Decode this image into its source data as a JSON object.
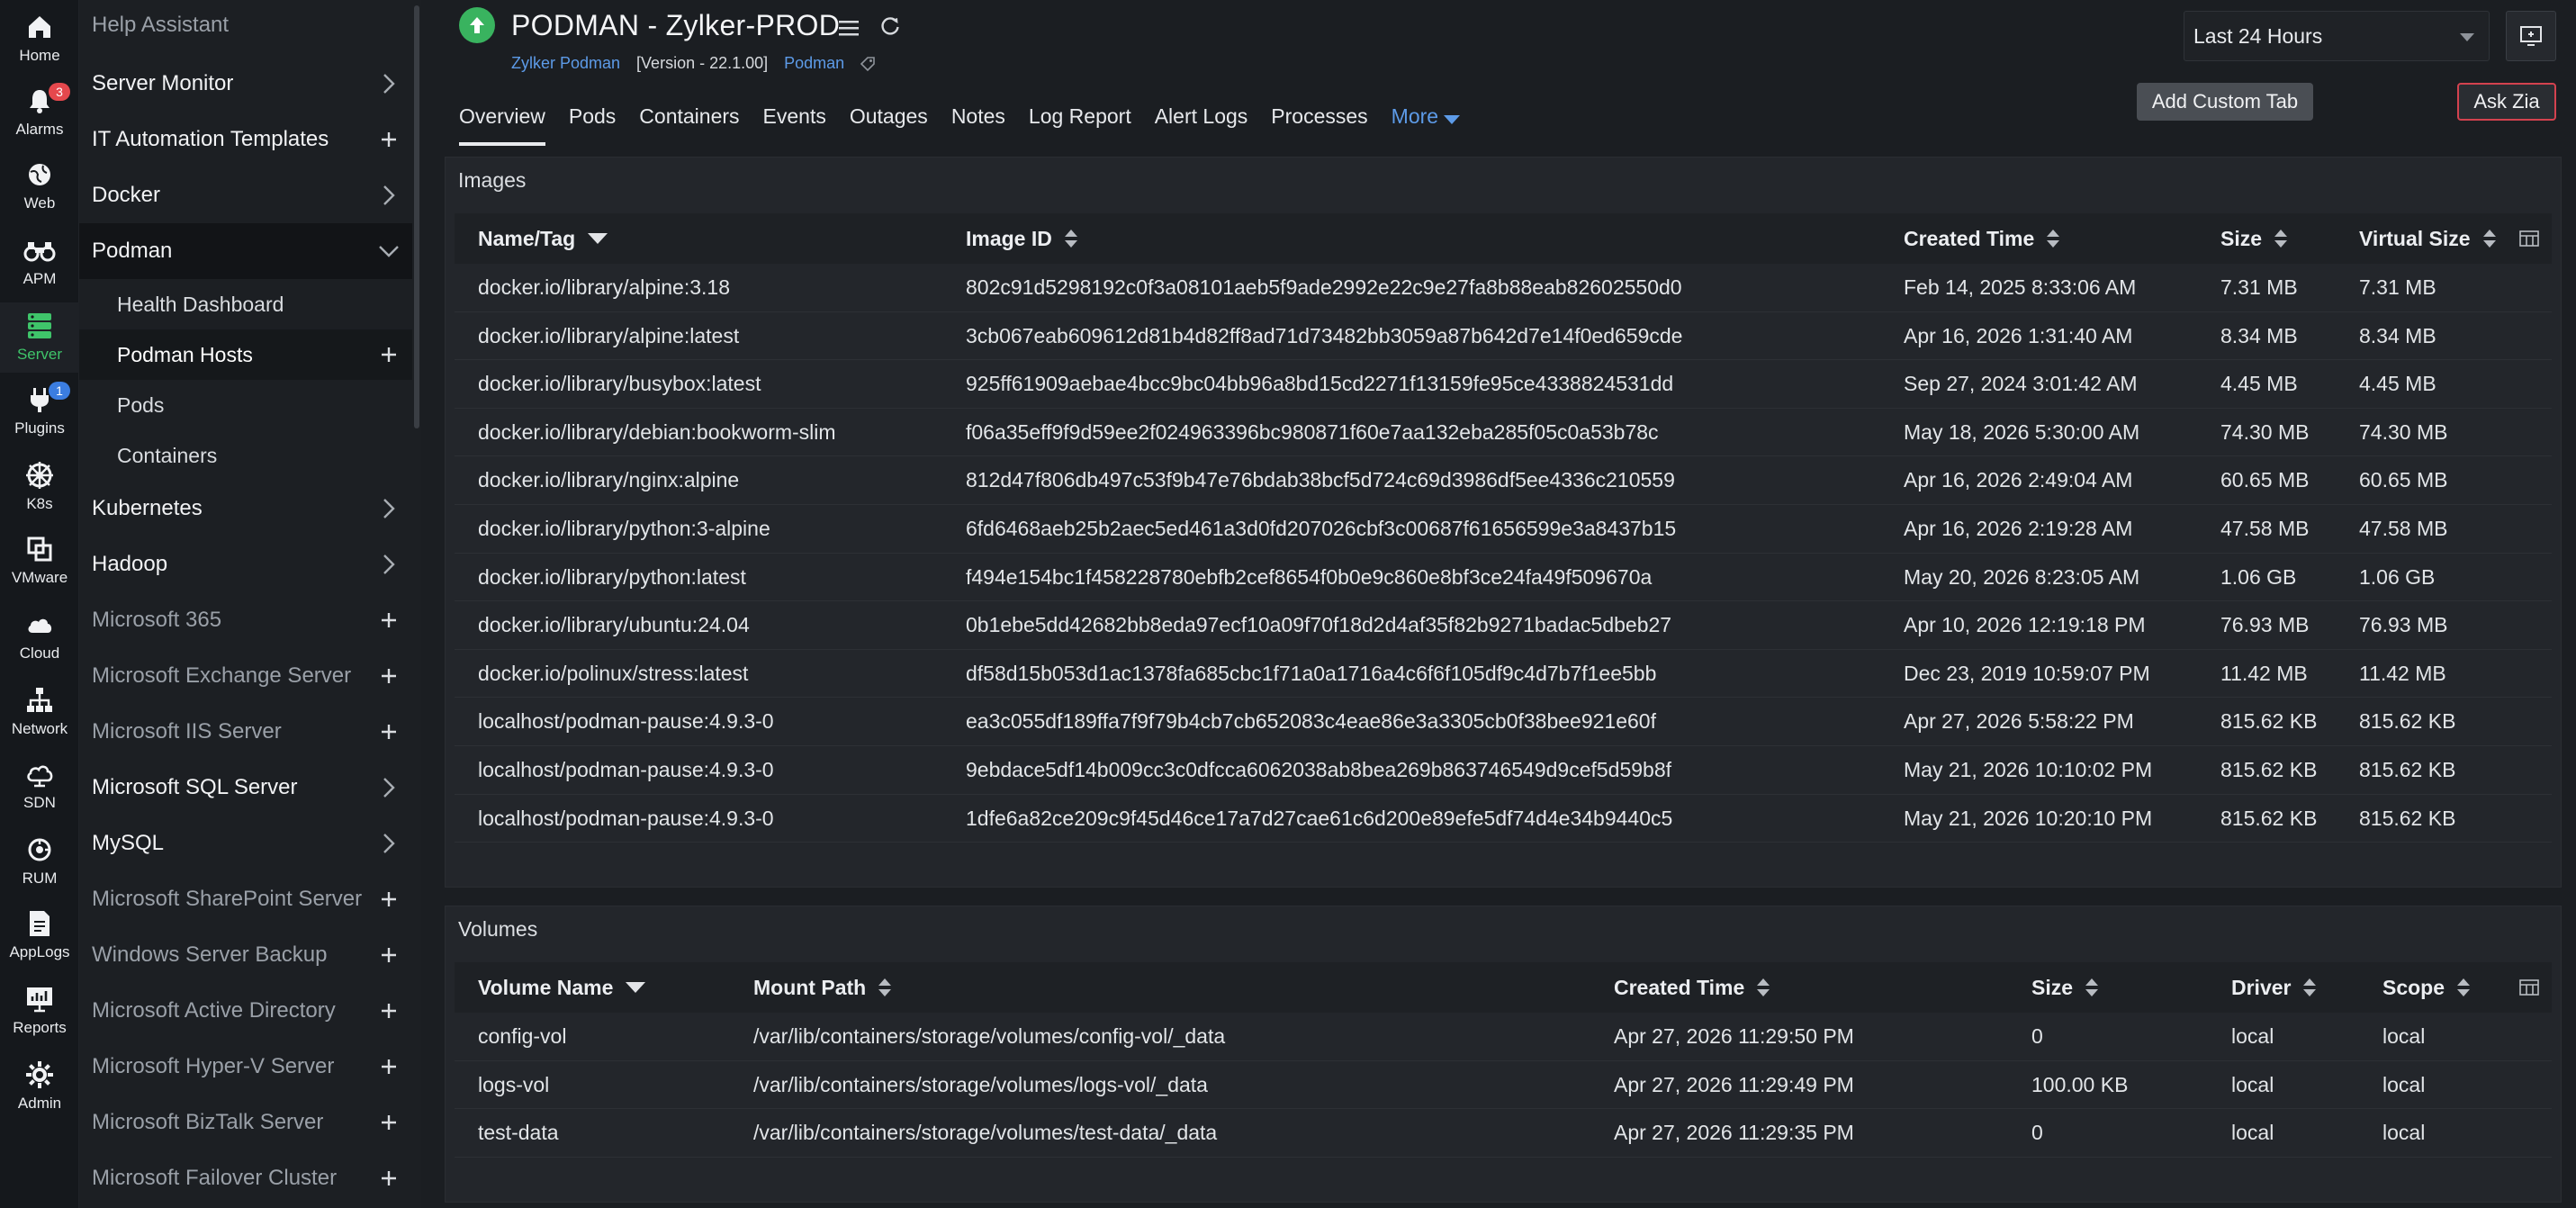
{
  "rail": [
    {
      "label": "Home",
      "icon": "home-icon"
    },
    {
      "label": "Alarms",
      "icon": "bell-icon",
      "badge": "3",
      "badge_color": "#e5484d"
    },
    {
      "label": "Web",
      "icon": "globe-icon"
    },
    {
      "label": "APM",
      "icon": "binoculars-icon"
    },
    {
      "label": "Server",
      "icon": "server-icon",
      "active": true
    },
    {
      "label": "Plugins",
      "icon": "plug-icon",
      "badge": "1",
      "badge_color": "#3b7de0"
    },
    {
      "label": "K8s",
      "icon": "helm-icon"
    },
    {
      "label": "VMware",
      "icon": "vmware-icon"
    },
    {
      "label": "Cloud",
      "icon": "cloud-icon"
    },
    {
      "label": "Network",
      "icon": "network-icon"
    },
    {
      "label": "SDN",
      "icon": "sdn-icon"
    },
    {
      "label": "RUM",
      "icon": "rum-icon"
    },
    {
      "label": "AppLogs",
      "icon": "applogs-icon"
    },
    {
      "label": "Reports",
      "icon": "reports-icon"
    },
    {
      "label": "Admin",
      "icon": "gear-icon"
    }
  ],
  "sidebar": {
    "items": [
      {
        "label": "Help Assistant",
        "control": "none",
        "dim": true
      },
      {
        "label": "Server Monitor",
        "control": "chevron"
      },
      {
        "label": "IT Automation Templates",
        "control": "plus"
      },
      {
        "label": "Docker",
        "control": "chevron"
      },
      {
        "label": "Podman",
        "control": "chevron-down",
        "open": true
      },
      {
        "label": "Health Dashboard",
        "sub": true
      },
      {
        "label": "Podman Hosts",
        "sub": true,
        "control": "plus",
        "selected": true
      },
      {
        "label": "Pods",
        "sub": true
      },
      {
        "label": "Containers",
        "sub": true
      },
      {
        "label": "Kubernetes",
        "control": "chevron"
      },
      {
        "label": "Hadoop",
        "control": "chevron"
      },
      {
        "label": "Microsoft 365",
        "control": "plus",
        "dim": true
      },
      {
        "label": "Microsoft Exchange Server",
        "control": "plus",
        "dim": true
      },
      {
        "label": "Microsoft IIS Server",
        "control": "plus",
        "dim": true
      },
      {
        "label": "Microsoft SQL Server",
        "control": "chevron"
      },
      {
        "label": "MySQL",
        "control": "chevron"
      },
      {
        "label": "Microsoft SharePoint Server",
        "control": "plus",
        "dim": true
      },
      {
        "label": "Windows Server Backup",
        "control": "plus",
        "dim": true
      },
      {
        "label": "Microsoft Active Directory",
        "control": "plus",
        "dim": true
      },
      {
        "label": "Microsoft Hyper-V Server",
        "control": "plus",
        "dim": true
      },
      {
        "label": "Microsoft BizTalk Server",
        "control": "plus",
        "dim": true
      },
      {
        "label": "Microsoft Failover Cluster",
        "control": "plus",
        "dim": true
      }
    ]
  },
  "header": {
    "title": "PODMAN - Zylker-PROD",
    "monitor_name": "Zylker Podman",
    "version": "[Version - 22.1.00]",
    "type_link": "Podman",
    "time_range": "Last 24 Hours",
    "add_custom_tab": "Add Custom Tab",
    "ask_zia": "Ask Zia"
  },
  "tabs": [
    "Overview",
    "Pods",
    "Containers",
    "Events",
    "Outages",
    "Notes",
    "Log Report",
    "Alert Logs",
    "Processes"
  ],
  "tabs_more": "More",
  "images": {
    "title": "Images",
    "columns": [
      "Name/Tag",
      "Image ID",
      "Created Time",
      "Size",
      "Virtual Size"
    ],
    "rows": [
      [
        "docker.io/library/alpine:3.18",
        "802c91d5298192c0f3a08101aeb5f9ade2992e22c9e27fa8b88eab82602550d0",
        "Feb 14, 2025 8:33:06 AM",
        "7.31 MB",
        "7.31 MB"
      ],
      [
        "docker.io/library/alpine:latest",
        "3cb067eab609612d81b4d82ff8ad71d73482bb3059a87b642d7e14f0ed659cde",
        "Apr 16, 2026 1:31:40 AM",
        "8.34 MB",
        "8.34 MB"
      ],
      [
        "docker.io/library/busybox:latest",
        "925ff61909aebae4bcc9bc04bb96a8bd15cd2271f13159fe95ce4338824531dd",
        "Sep 27, 2024 3:01:42 AM",
        "4.45 MB",
        "4.45 MB"
      ],
      [
        "docker.io/library/debian:bookworm-slim",
        "f06a35eff9f9d59ee2f024963396bc980871f60e7aa132eba285f05c0a53b78c",
        "May 18, 2026 5:30:00 AM",
        "74.30 MB",
        "74.30 MB"
      ],
      [
        "docker.io/library/nginx:alpine",
        "812d47f806db497c53f9b47e76bdab38bcf5d724c69d3986df5ee4336c210559",
        "Apr 16, 2026 2:49:04 AM",
        "60.65 MB",
        "60.65 MB"
      ],
      [
        "docker.io/library/python:3-alpine",
        "6fd6468aeb25b2aec5ed461a3d0fd207026cbf3c00687f61656599e3a8437b15",
        "Apr 16, 2026 2:19:28 AM",
        "47.58 MB",
        "47.58 MB"
      ],
      [
        "docker.io/library/python:latest",
        "f494e154bc1f458228780ebfb2cef8654f0b0e9c860e8bf3ce24fa49f509670a",
        "May 20, 2026 8:23:05 AM",
        "1.06 GB",
        "1.06 GB"
      ],
      [
        "docker.io/library/ubuntu:24.04",
        "0b1ebe5dd42682bb8eda97ecf10a09f70f18d2d4af35f82b9271badac5dbeb27",
        "Apr 10, 2026 12:19:18 PM",
        "76.93 MB",
        "76.93 MB"
      ],
      [
        "docker.io/polinux/stress:latest",
        "df58d15b053d1ac1378fa685cbc1f71a0a1716a4c6f6f105df9c4d7b7f1ee5bb",
        "Dec 23, 2019 10:59:07 PM",
        "11.42 MB",
        "11.42 MB"
      ],
      [
        "localhost/podman-pause:4.9.3-0",
        "ea3c055df189ffa7f9f79b4cb7cb652083c4eae86e3a3305cb0f38bee921e60f",
        "Apr 27, 2026 5:58:22 PM",
        "815.62 KB",
        "815.62 KB"
      ],
      [
        "localhost/podman-pause:4.9.3-0",
        "9ebdace5df14b009cc3c0dfcca6062038ab8bea269b863746549d9cef5d59b8f",
        "May 21, 2026 10:10:02 PM",
        "815.62 KB",
        "815.62 KB"
      ],
      [
        "localhost/podman-pause:4.9.3-0",
        "1dfe6a82ce209c9f45d46ce17a7d27cae61c6d200e89efe5df74d4e34b9440c5",
        "May 21, 2026 10:20:10 PM",
        "815.62 KB",
        "815.62 KB"
      ]
    ]
  },
  "volumes": {
    "title": "Volumes",
    "columns": [
      "Volume Name",
      "Mount Path",
      "Created Time",
      "Size",
      "Driver",
      "Scope"
    ],
    "rows": [
      [
        "config-vol",
        "/var/lib/containers/storage/volumes/config-vol/_data",
        "Apr 27, 2026 11:29:50 PM",
        "0",
        "local",
        "local"
      ],
      [
        "logs-vol",
        "/var/lib/containers/storage/volumes/logs-vol/_data",
        "Apr 27, 2026 11:29:49 PM",
        "100.00 KB",
        "local",
        "local"
      ],
      [
        "test-data",
        "/var/lib/containers/storage/volumes/test-data/_data",
        "Apr 27, 2026 11:29:35 PM",
        "0",
        "local",
        "local"
      ]
    ]
  },
  "colors": {
    "accent_green": "#3fc46a",
    "link_blue": "#5d9be8",
    "zia_border": "#d3424f"
  }
}
